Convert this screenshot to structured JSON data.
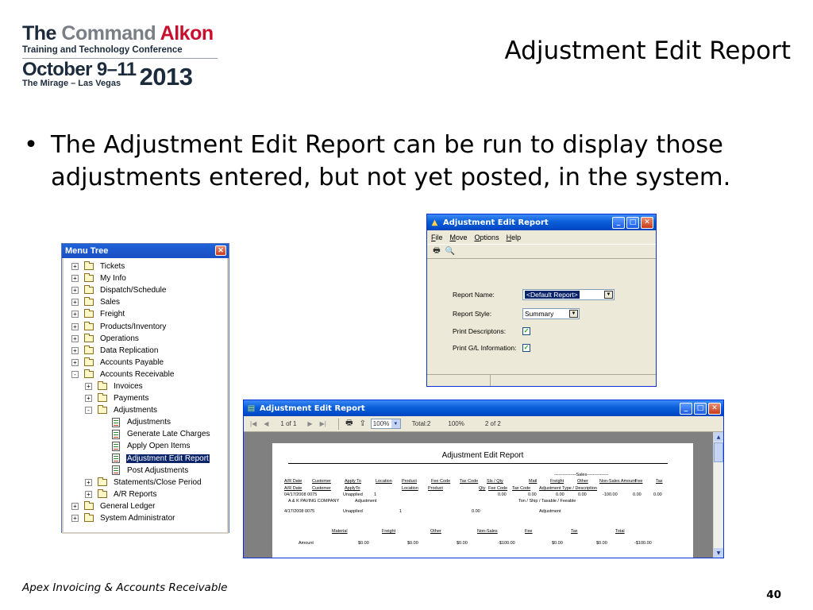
{
  "logo": {
    "line1_the": "The",
    "line1_command": "Command",
    "line1_alkon": "Alkon",
    "line2": "Training and Technology Conference",
    "dates": "October 9–11",
    "venue": "The Mirage – Las Vegas",
    "year": "2013"
  },
  "slide": {
    "title": "Adjustment Edit Report",
    "bullet_symbol": "•",
    "bullet": "The Adjustment Edit Report can be run to display those adjustments entered, but not yet posted, in the system.",
    "footer_left": "Apex Invoicing & Accounts Receivable",
    "page_number": "40"
  },
  "menu_tree": {
    "title": "Menu Tree",
    "items": [
      {
        "label": "Tickets",
        "level": 0,
        "expander": "+",
        "icon": "folder-icon"
      },
      {
        "label": "My Info",
        "level": 0,
        "expander": "+",
        "icon": "folder-icon"
      },
      {
        "label": "Dispatch/Schedule",
        "level": 0,
        "expander": "+",
        "icon": "folder-icon"
      },
      {
        "label": "Sales",
        "level": 0,
        "expander": "+",
        "icon": "folder-icon"
      },
      {
        "label": "Freight",
        "level": 0,
        "expander": "+",
        "icon": "folder-icon"
      },
      {
        "label": "Products/Inventory",
        "level": 0,
        "expander": "+",
        "icon": "folder-icon"
      },
      {
        "label": "Operations",
        "level": 0,
        "expander": "+",
        "icon": "folder-icon"
      },
      {
        "label": "Data Replication",
        "level": 0,
        "expander": "+",
        "icon": "folder-icon"
      },
      {
        "label": "Accounts Payable",
        "level": 0,
        "expander": "+",
        "icon": "folder-icon"
      },
      {
        "label": "Accounts Receivable",
        "level": 0,
        "expander": "-",
        "icon": "folder-open-icon"
      },
      {
        "label": "Invoices",
        "level": 1,
        "expander": "+",
        "icon": "folder-icon"
      },
      {
        "label": "Payments",
        "level": 1,
        "expander": "+",
        "icon": "folder-icon"
      },
      {
        "label": "Adjustments",
        "level": 1,
        "expander": "-",
        "icon": "folder-open-icon"
      },
      {
        "label": "Adjustments",
        "level": 2,
        "expander": "",
        "icon": "edit-form-icon"
      },
      {
        "label": "Generate Late Charges",
        "level": 2,
        "expander": "",
        "icon": "calculator-icon"
      },
      {
        "label": "Apply Open Items",
        "level": 2,
        "expander": "",
        "icon": "apply-items-icon"
      },
      {
        "label": "Adjustment Edit Report",
        "level": 2,
        "expander": "",
        "icon": "report-icon",
        "selected": true
      },
      {
        "label": "Post Adjustments",
        "level": 2,
        "expander": "",
        "icon": "post-icon"
      },
      {
        "label": "Statements/Close Period",
        "level": 1,
        "expander": "+",
        "icon": "folder-icon"
      },
      {
        "label": "A/R Reports",
        "level": 1,
        "expander": "+",
        "icon": "folder-icon"
      },
      {
        "label": "General Ledger",
        "level": 0,
        "expander": "+",
        "icon": "folder-icon"
      },
      {
        "label": "System Administrator",
        "level": 0,
        "expander": "+",
        "icon": "folder-icon"
      }
    ]
  },
  "dialog": {
    "title": "Adjustment Edit Report",
    "menu": [
      "File",
      "Move",
      "Options",
      "Help"
    ],
    "menu_underline": [
      "F",
      "M",
      "O",
      "H"
    ],
    "fields": {
      "report_name_label": "Report Name:",
      "report_name_value": "<Default Report>",
      "report_style_label": "Report Style:",
      "report_style_value": "Summary",
      "print_descriptions_label": "Print Descriptons:",
      "print_descriptions_checked": true,
      "print_gl_label": "Print G/L Information:",
      "print_gl_checked": true
    }
  },
  "viewer": {
    "title": "Adjustment Edit Report",
    "page_indicator": "1 of 1",
    "zoom": "100%",
    "total": "Total:2",
    "percent": "100%",
    "count": "2 of 2",
    "report": {
      "title": "Adjustment Edit Report",
      "sales_group": "---------------Sales---------------",
      "header1": [
        "A/R Date",
        "Customer",
        "Apply To",
        "Location",
        "Product",
        "Fee Code",
        "Tax Code",
        "Sls / Qty",
        "Matl",
        "Freight",
        "Other",
        "Non-Sales Amount",
        "Fee",
        "Tax"
      ],
      "header2": [
        "A/R Date",
        "Customer",
        "ApplyTo",
        "Location",
        "Product",
        "Qty",
        "Fee Code",
        "Tax Code",
        "Adjustment Type / Description"
      ],
      "row1": [
        "04/17/2008 0075",
        "Unapplied",
        "1",
        "0.00",
        "0.00",
        "0.00",
        "0.00",
        "-100.00",
        "0.00",
        "0.00"
      ],
      "row1_desc": "A & K PAVING COMPANY",
      "row1_adj": "Adjustment",
      "row1_type": "Ton / Ship / Taxable / Feeable",
      "row2": [
        "4/17/2008 0075",
        "Unapplied",
        "1",
        "0.00"
      ],
      "row2_adj": "Adjustment",
      "totals_headers": [
        "Material",
        "Freight",
        "Other",
        "Non-Sales",
        "Fee",
        "Tax",
        "Total"
      ],
      "totals_label": "Amount",
      "totals_values": [
        "$0.00",
        "$0.00",
        "$0.00",
        "-$100.00",
        "$0.00",
        "$0.00",
        "-$100.00"
      ]
    }
  }
}
